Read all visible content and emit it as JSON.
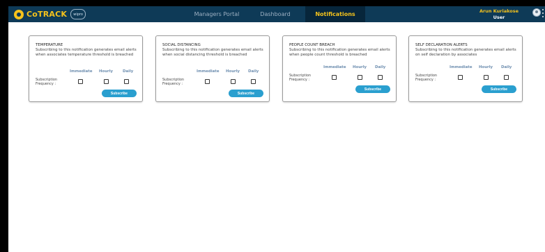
{
  "header": {
    "logo_text": "CoTRACK",
    "logo_badge": "wipro",
    "nav": [
      {
        "label": "Managers Portal"
      },
      {
        "label": "Dashboard"
      },
      {
        "label": "Notifications"
      }
    ],
    "user_name": "Arun Kuriakose",
    "user_role": "User"
  },
  "frequency": {
    "immediate": "Immediate",
    "hourly": "Hourly",
    "daily": "Daily",
    "label_line1": "Subscription",
    "label_line2": "Frequency :"
  },
  "cards": [
    {
      "title": "TEMPERATURE",
      "description": "Subscribing to this notification generates email alerts when associates temperature threshold is breached",
      "button": "Subscribe"
    },
    {
      "title": "SOCIAL DISTANCING",
      "description": "Subscribing to this notification generates email alerts when social distancing threshold is breached",
      "button": "Subscribe"
    },
    {
      "title": "PEOPLE COUNT BREACH",
      "description": "Subscribing to this notification generates email alerts when people count threshold is breached",
      "button": "Subscribe"
    },
    {
      "title": "SELF DECLARATION ALERTS",
      "description": "Subscribing to this notification generates email alerts on self declaration by associates",
      "button": "Subscribe"
    }
  ],
  "colors": {
    "header_bg": "#0e3a57",
    "accent": "#f4c21c",
    "button": "#2a9fcf"
  }
}
